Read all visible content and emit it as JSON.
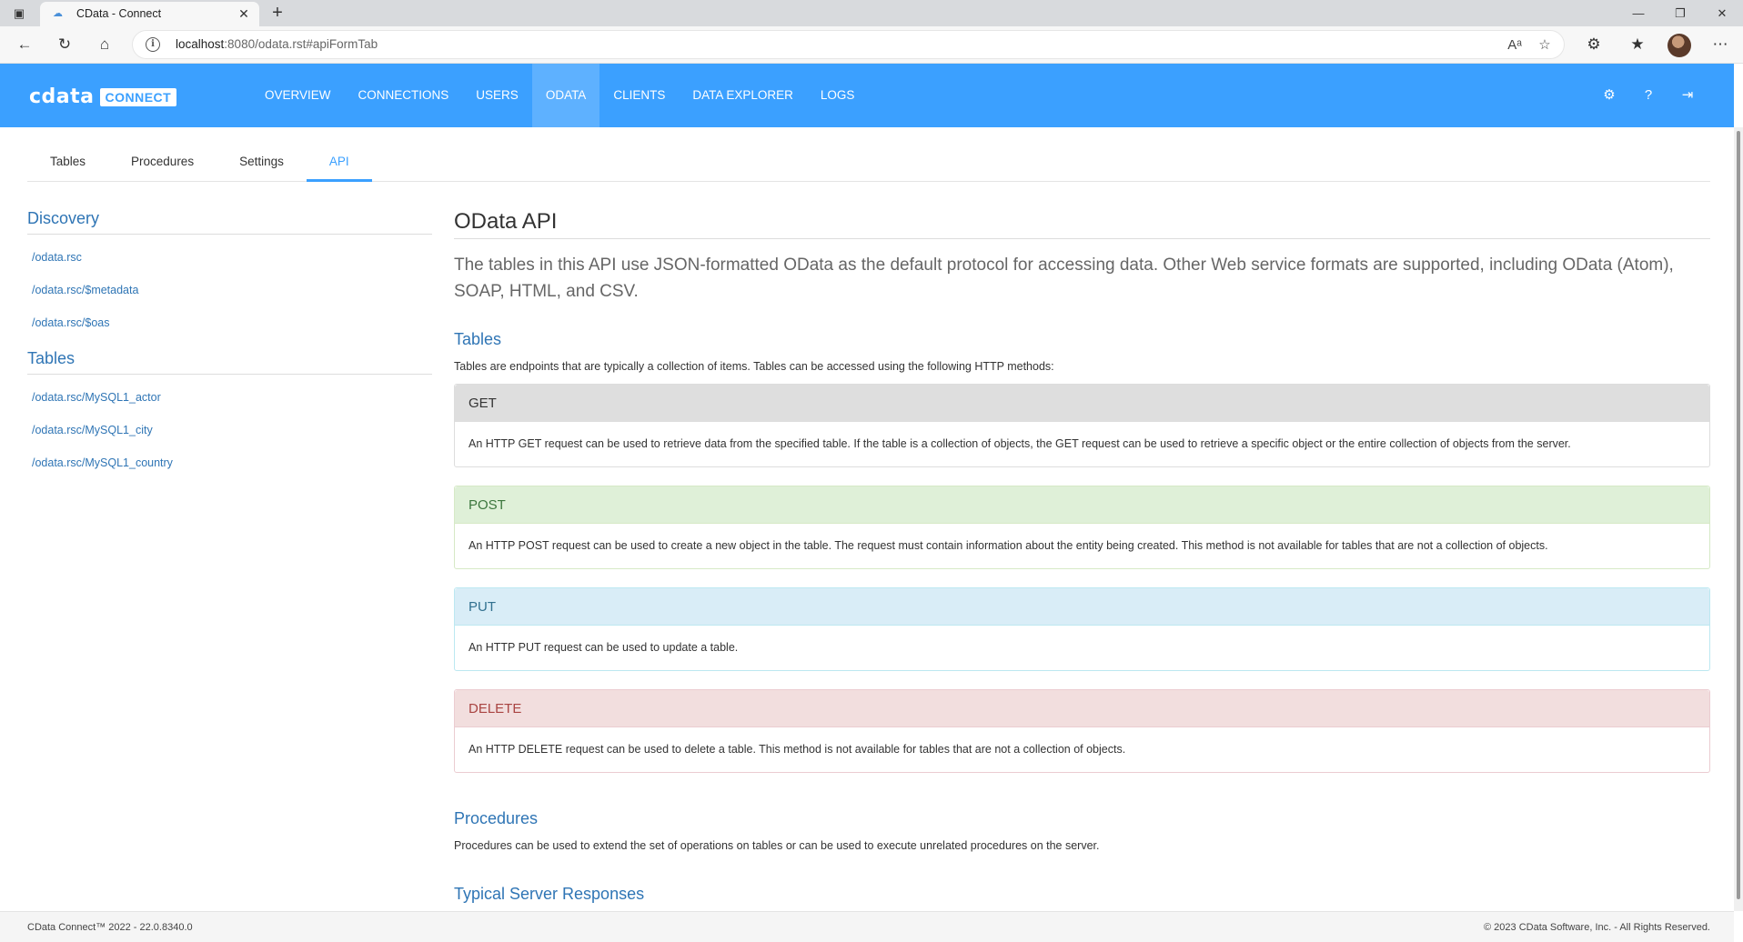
{
  "browser": {
    "tab_title": "CData - Connect",
    "url_host": "localhost",
    "url_rest": ":8080/odata.rst#apiFormTab"
  },
  "header": {
    "logo_text": "cdata",
    "logo_badge": "CONNECT",
    "nav": [
      {
        "label": "OVERVIEW"
      },
      {
        "label": "CONNECTIONS"
      },
      {
        "label": "USERS"
      },
      {
        "label": "ODATA"
      },
      {
        "label": "CLIENTS"
      },
      {
        "label": "DATA EXPLORER"
      },
      {
        "label": "LOGS"
      }
    ],
    "active_nav": "ODATA",
    "accent_color": "#3ba0ff"
  },
  "subtabs": [
    {
      "label": "Tables"
    },
    {
      "label": "Procedures"
    },
    {
      "label": "Settings"
    },
    {
      "label": "API"
    }
  ],
  "sidebar": {
    "discovery_title": "Discovery",
    "discovery_links": [
      "/odata.rsc",
      "/odata.rsc/$metadata",
      "/odata.rsc/$oas"
    ],
    "tables_title": "Tables",
    "table_links": [
      "/odata.rsc/MySQL1_actor",
      "/odata.rsc/MySQL1_city",
      "/odata.rsc/MySQL1_country"
    ]
  },
  "main": {
    "title": "OData API",
    "lead": "The tables in this API use JSON-formatted OData as the default protocol for accessing data. Other Web service formats are supported, including OData (Atom), SOAP, HTML, and CSV.",
    "tables_heading": "Tables",
    "tables_desc": "Tables are endpoints that are typically a collection of items. Tables can be accessed using the following HTTP methods:",
    "methods": {
      "get": {
        "name": "GET",
        "desc": "An HTTP GET request can be used to retrieve data from the specified table. If the table is a collection of objects, the GET request can be used to retrieve a specific object or the entire collection of objects from the server."
      },
      "post": {
        "name": "POST",
        "desc": "An HTTP POST request can be used to create a new object in the table. The request must contain information about the entity being created. This method is not available for tables that are not a collection of objects."
      },
      "put": {
        "name": "PUT",
        "desc": "An HTTP PUT request can be used to update a table."
      },
      "delete": {
        "name": "DELETE",
        "desc": "An HTTP DELETE request can be used to delete a table. This method is not available for tables that are not a collection of objects."
      }
    },
    "procedures_heading": "Procedures",
    "procedures_desc": "Procedures can be used to extend the set of operations on tables or can be used to execute unrelated procedures on the server.",
    "responses_heading": "Typical Server Responses"
  },
  "footer": {
    "version": "CData Connect™ 2022 - 22.0.8340.0",
    "copyright": "© 2023 CData Software, Inc. - All Rights Reserved."
  }
}
